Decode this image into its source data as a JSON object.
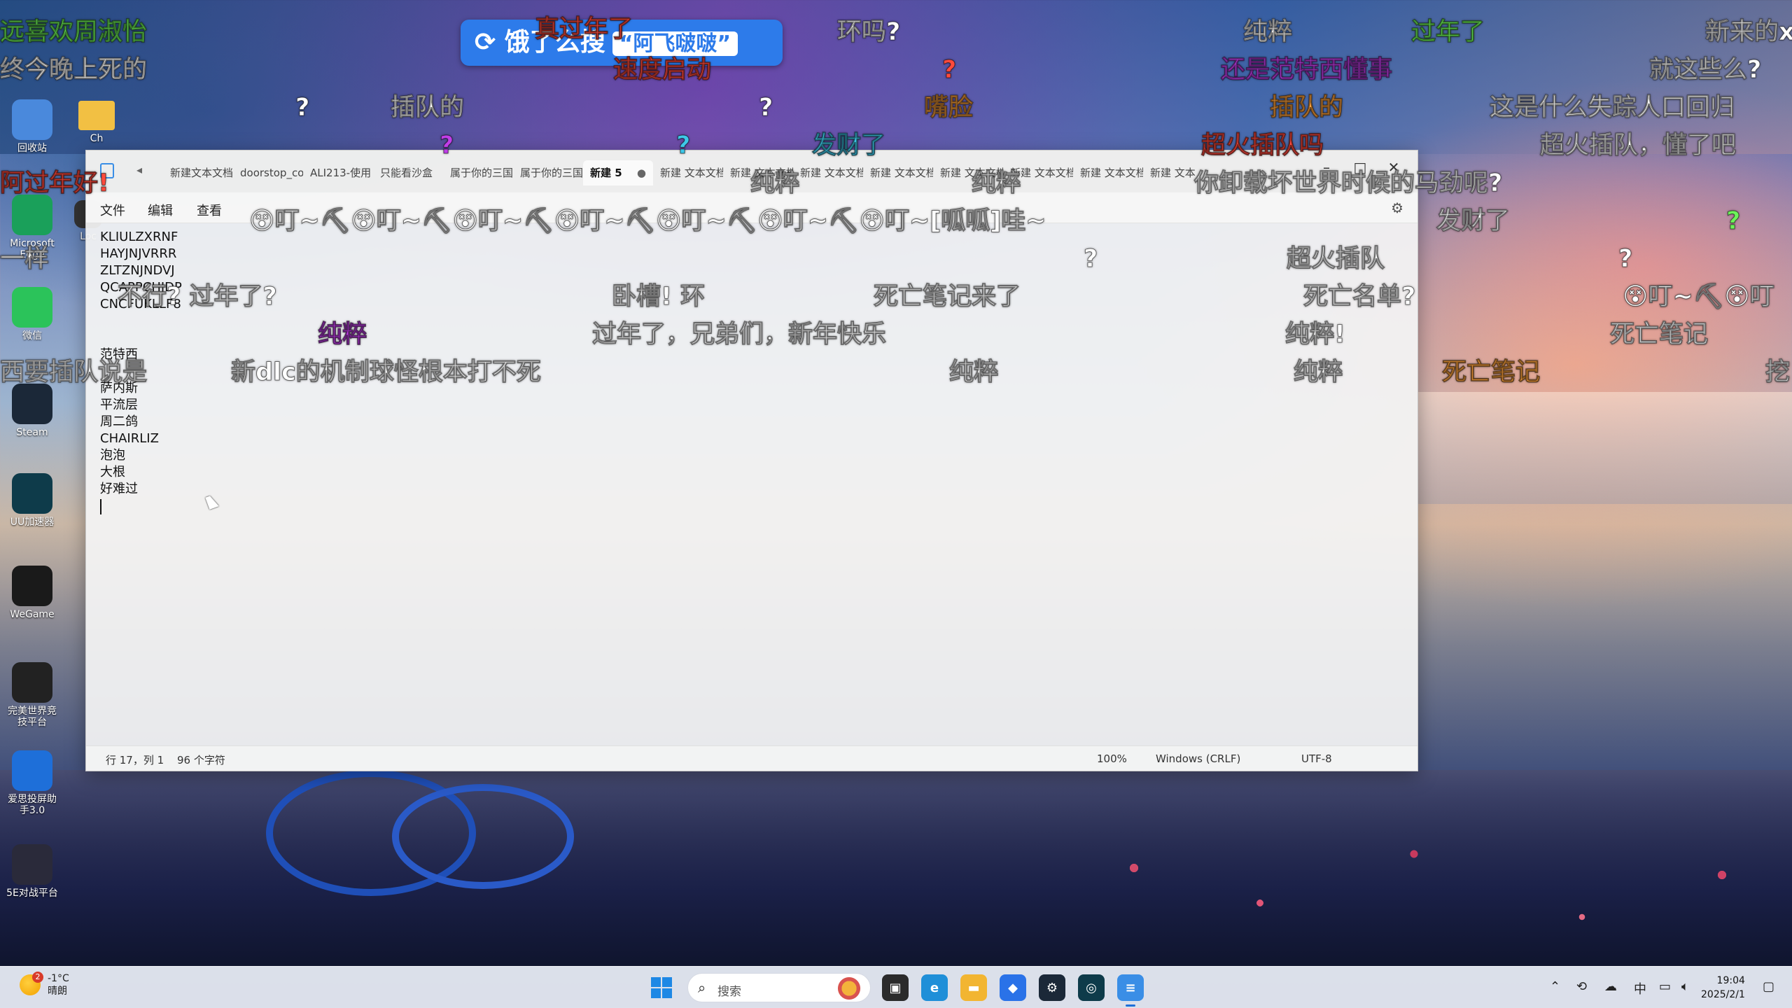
{
  "desktop": {
    "icons": [
      {
        "label": "回收站",
        "icon": "recycle-bin-icon",
        "color": "#4a89dc"
      },
      {
        "label": "Microsoft Edge",
        "icon": "edge-icon",
        "color": "#1aa05a"
      },
      {
        "label": "微信",
        "icon": "wechat-icon",
        "color": "#2bc35a"
      },
      {
        "label": "Steam",
        "icon": "steam-icon",
        "color": "#1b2838"
      },
      {
        "label": "UU加速器",
        "icon": "uu-accelerator-icon",
        "color": "#0e3b4a"
      },
      {
        "label": "WeGame",
        "icon": "wegame-icon",
        "color": "#1a1a1a"
      },
      {
        "label": "完美世界竞技平台",
        "icon": "perfect-world-icon",
        "color": "#222"
      },
      {
        "label": "爱思投屏助手3.0",
        "icon": "aisi-icon",
        "color": "#1e6fd9"
      },
      {
        "label": "5E对战平台",
        "icon": "5e-icon",
        "color": "#2a2a3a"
      }
    ],
    "second_column": [
      {
        "label": "Ch",
        "icon": "folder-icon"
      },
      {
        "label": "Loc",
        "icon": "app-icon"
      }
    ]
  },
  "notepad": {
    "tab_scroll": "◂",
    "tabs": [
      {
        "label": "新建文本文档"
      },
      {
        "label": "doorstop_co"
      },
      {
        "label": "ALI213-使用"
      },
      {
        "label": "只能看沙盒"
      },
      {
        "label": "属于你的三国"
      },
      {
        "label": "属于你的三国"
      },
      {
        "label": "新建 5",
        "active": true,
        "dot": "●"
      },
      {
        "label": "新建 文本文档"
      },
      {
        "label": "新建 文本文档"
      },
      {
        "label": "新建 文本文档"
      },
      {
        "label": "新建 文本文档"
      },
      {
        "label": "新建 文本文档"
      },
      {
        "label": "新建 文本文档"
      },
      {
        "label": "新建 文本文档"
      },
      {
        "label": "新建 文本"
      }
    ],
    "window_controls": {
      "minimize": "–",
      "maximize": "□",
      "close": "✕"
    },
    "menu": {
      "file": "文件",
      "edit": "编辑",
      "view": "查看"
    },
    "lines": [
      "KLIULZXRNF",
      "HAYJNJVRRR",
      "ZLTZNJNDVJ",
      "QCAPPCHJDP",
      "CNCFUKLLF8",
      "",
      "",
      "范特西",
      "",
      "萨内斯",
      "平流层",
      "周二鸽",
      "CHAIRLIZ",
      "泡泡",
      "大根",
      "好难过"
    ],
    "status": {
      "position": "行 17，列 1",
      "chars": "96 个字符",
      "zoom": "100%",
      "line_ending": "Windows (CRLF)",
      "encoding": "UTF-8"
    }
  },
  "overlay": {
    "banner_prefix": "饿了么搜",
    "banner_highlight": "“阿飞啵啵”",
    "danmaku": [
      {
        "text": "远喜欢周淑怡",
        "color": "#6df25a"
      },
      {
        "text": "终今晚上死的",
        "color": "#ffffff"
      },
      {
        "text": "真过年了",
        "color": "#ff4a3d"
      },
      {
        "text": "速度启动",
        "color": "#ff4a3d"
      },
      {
        "text": "环吗?",
        "color": "#ffffff"
      },
      {
        "text": "纯粹",
        "color": "#ffffff"
      },
      {
        "text": "过年了",
        "color": "#6df25a"
      },
      {
        "text": "新来的x",
        "color": "#ffffff"
      },
      {
        "text": "?",
        "color": "#ffffff"
      },
      {
        "text": "插队的",
        "color": "#ffffff"
      },
      {
        "text": "?",
        "color": "#ffffff"
      },
      {
        "text": "?",
        "color": "#ff4a3d"
      },
      {
        "text": "嘴脸",
        "color": "#ffa23d"
      },
      {
        "text": "还是范特西懂事",
        "color": "#c03ee8"
      },
      {
        "text": "就这些么?",
        "color": "#ffffff"
      },
      {
        "text": "插队的",
        "color": "#ffa23d"
      },
      {
        "text": "这是什么失踪人口回归",
        "color": "#ffffff"
      },
      {
        "text": "?",
        "color": "#c03ee8"
      },
      {
        "text": "?",
        "color": "#3ec7e8"
      },
      {
        "text": "发财了",
        "color": "#3ec7e8"
      },
      {
        "text": "超火插队吗",
        "color": "#ff4a3d"
      },
      {
        "text": "超火插队，懂了吧",
        "color": "#ffffff"
      },
      {
        "text": "阿过年好!",
        "color": "#ff4a3d"
      },
      {
        "text": "纯粹",
        "color": "#ffffff"
      },
      {
        "text": "纯粹",
        "color": "#ffffff"
      },
      {
        "text": "你卸载坏世界时候的马劲呢?",
        "color": "#ffffff"
      },
      {
        "text": "发财了",
        "color": "#ffffff"
      },
      {
        "text": "?",
        "color": "#6df25a"
      },
      {
        "text": "一样",
        "color": "#ffffff"
      },
      {
        "text": "😵叮~⛏😵叮~⛏😵叮~⛏😵叮~⛏😵叮~⛏😵叮~⛏😵叮~[呱呱]哇~",
        "color": "#ffffff"
      },
      {
        "text": "?",
        "color": "#ffffff"
      },
      {
        "text": "超火插队",
        "color": "#ffffff"
      },
      {
        "text": "?",
        "color": "#ffffff"
      },
      {
        "text": "不行? 过年了?",
        "color": "#ffffff"
      },
      {
        "text": "卧槽! 环",
        "color": "#ffffff"
      },
      {
        "text": "死亡笔记来了",
        "color": "#ffffff"
      },
      {
        "text": "死亡名单?",
        "color": "#ffffff"
      },
      {
        "text": "😵叮~⛏😵叮",
        "color": "#ffffff"
      },
      {
        "text": "纯粹",
        "color": "#c03ee8"
      },
      {
        "text": "过年了，兄弟们，新年快乐",
        "color": "#ffffff"
      },
      {
        "text": "纯粹!",
        "color": "#ffffff"
      },
      {
        "text": "死亡笔记",
        "color": "#ffffff"
      },
      {
        "text": "西要插队说是",
        "color": "#ffffff"
      },
      {
        "text": "新dlc的机制球怪根本打不死",
        "color": "#ffffff"
      },
      {
        "text": "纯粹",
        "color": "#ffffff"
      },
      {
        "text": "纯粹",
        "color": "#ffffff"
      },
      {
        "text": "死亡笔记",
        "color": "#ffa23d"
      },
      {
        "text": "挖",
        "color": "#ffffff"
      }
    ]
  },
  "taskbar": {
    "weather_badge": "2",
    "weather_temp": "-1°C",
    "weather_desc": "晴朗",
    "search_placeholder": "搜索",
    "apps": [
      {
        "icon": "task-view-icon",
        "color": "#2b2b2b",
        "glyph": "▣"
      },
      {
        "icon": "edge-icon",
        "color": "#1f8fd8",
        "glyph": "e"
      },
      {
        "icon": "file-explorer-icon",
        "color": "#f2b531",
        "glyph": "▬"
      },
      {
        "icon": "app-blue-icon",
        "color": "#2a72e8",
        "glyph": "◆"
      },
      {
        "icon": "steam-icon",
        "color": "#1b2838",
        "glyph": "⚙"
      },
      {
        "icon": "uu-accelerator-icon",
        "color": "#0e3b4a",
        "glyph": "◎"
      },
      {
        "icon": "notepad-icon",
        "color": "#3a8ee6",
        "glyph": "≡"
      }
    ],
    "tray_ime": "中",
    "time": "19:04",
    "date": "2025/2/1"
  }
}
